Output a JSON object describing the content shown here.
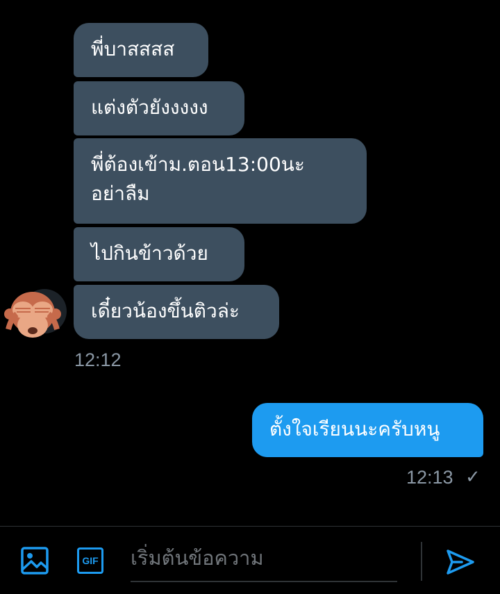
{
  "conversation": {
    "incoming": [
      {
        "lines": [
          "พี่บาสสสส"
        ]
      },
      {
        "lines": [
          "แต่งตัวยังงงงง"
        ]
      },
      {
        "lines": [
          "พี่ต้องเข้าม.ตอน13:00นะ",
          "อย่าลืม"
        ]
      },
      {
        "lines": [
          "ไปกินข้าวด้วย"
        ]
      },
      {
        "lines": [
          "เดี๋ยวน้องขึ้นติวล่ะ"
        ]
      }
    ],
    "incoming_time": "12:12",
    "outgoing": [
      {
        "lines": [
          "ตั้งใจเรียนนะครับหนู"
        ]
      }
    ],
    "outgoing_time": "12:13",
    "outgoing_status_icon": "check-icon"
  },
  "avatar": {
    "icon": "see-no-evil-monkey"
  },
  "composer": {
    "placeholder": "เริ่มต้นข้อความ",
    "media_icon": "image-icon",
    "gif_label": "GIF",
    "send_icon": "send-icon"
  },
  "colors": {
    "background": "#000000",
    "incoming_bubble": "#3d4f5f",
    "outgoing_bubble": "#1d9bf0",
    "accent": "#1d9bf0",
    "muted_text": "#8b98a5"
  }
}
